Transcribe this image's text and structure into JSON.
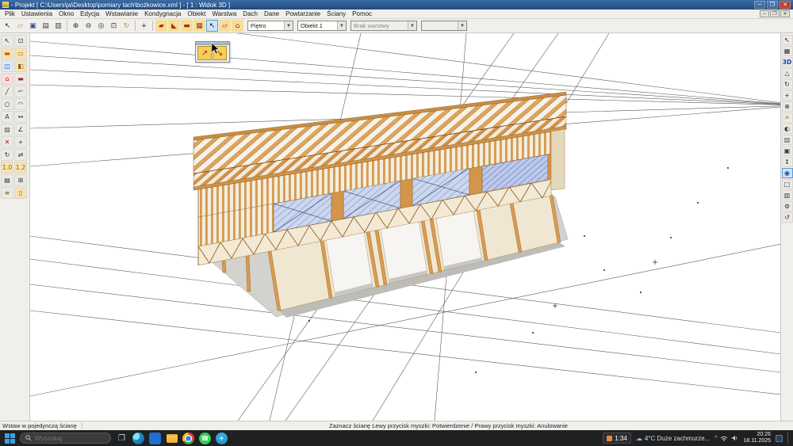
{
  "window": {
    "title": "- Projekt [ C:\\Users\\ja\\Desktop\\pomiary tach\\bożkowice.xml ] - [ 1 : Widok 3D ]",
    "controls": {
      "minimize": "─",
      "maximize": "❐",
      "close": "✕"
    }
  },
  "menu": {
    "items": [
      {
        "name": "menu-plik",
        "label": "Plik"
      },
      {
        "name": "menu-ustawienia",
        "label": "Ustawienia"
      },
      {
        "name": "menu-okno",
        "label": "Okno"
      },
      {
        "name": "menu-edycja",
        "label": "Edycja"
      },
      {
        "name": "menu-wstawianie",
        "label": "Wstawianie"
      },
      {
        "name": "menu-kondygnacja",
        "label": "Kondygnacja"
      },
      {
        "name": "menu-obiekt",
        "label": "Obiekt"
      },
      {
        "name": "menu-warstwa",
        "label": "Warstwa"
      },
      {
        "name": "menu-dach",
        "label": "Dach"
      },
      {
        "name": "menu-dane",
        "label": "Dane"
      },
      {
        "name": "menu-powtarzanie",
        "label": "Powtarzanie"
      },
      {
        "name": "menu-sciany",
        "label": "Ściany"
      },
      {
        "name": "menu-pomoc",
        "label": "Pomoc"
      }
    ],
    "mdi_controls": {
      "minimize": "─",
      "restore": "❐",
      "close": "✕"
    }
  },
  "toolbar": {
    "buttons": [
      {
        "name": "select-button",
        "glyph": "↖",
        "color": "#222"
      },
      {
        "name": "open-button",
        "glyph": "▱",
        "color": "#c09020"
      },
      {
        "name": "save-button",
        "glyph": "▣",
        "color": "#33518c"
      },
      {
        "name": "print-button",
        "glyph": "▤",
        "color": "#444"
      },
      {
        "name": "print-preview-button",
        "glyph": "▥",
        "color": "#444"
      },
      {
        "sep": true
      },
      {
        "name": "zoom-in-button",
        "glyph": "⊕",
        "color": "#333"
      },
      {
        "name": "zoom-out-button",
        "glyph": "⊖",
        "color": "#333"
      },
      {
        "name": "zoom-fit-button",
        "glyph": "◎",
        "color": "#333"
      },
      {
        "name": "zoom-window-button",
        "glyph": "⊡",
        "color": "#333"
      },
      {
        "name": "refresh-button",
        "glyph": "↻",
        "color": "#c8941a"
      },
      {
        "sep": true
      },
      {
        "name": "pan-view-button",
        "glyph": "+",
        "color": "#333"
      },
      {
        "sep": true
      },
      {
        "name": "wall-insert-button",
        "glyph": "▰",
        "color": "#b43010",
        "bg": "#f4df9a"
      },
      {
        "name": "roof-insert-button",
        "glyph": "◣",
        "color": "#b43010",
        "bg": "#f4df9a"
      },
      {
        "name": "beam-insert-button",
        "glyph": "▬",
        "color": "#b43010",
        "bg": "#f4df9a"
      },
      {
        "name": "panel-insert-button",
        "glyph": "▦",
        "color": "#b43010",
        "bg": "#f4df9a"
      },
      {
        "name": "pointer-mode-button",
        "glyph": "↖",
        "color": "#111",
        "active": true
      },
      {
        "name": "wall2-insert-button",
        "glyph": "▱",
        "color": "#b43010",
        "bg": "#f4df9a"
      },
      {
        "name": "roof2-insert-button",
        "glyph": "⌂",
        "color": "#b43010",
        "bg": "#f4df9a"
      }
    ],
    "combos": [
      {
        "name": "floor-combo",
        "value": "Piętro"
      },
      {
        "name": "object-combo",
        "value": "Obiekt 1"
      },
      {
        "name": "layer-combo",
        "value": "Brak warstwy"
      },
      {
        "name": "extra-combo",
        "value": ""
      }
    ]
  },
  "palette": {
    "buttons": [
      {
        "name": "insert-single-wall-button",
        "glyph": "↗"
      },
      {
        "name": "insert-wall-chain-button",
        "glyph": "↘"
      }
    ]
  },
  "left_toolbar": {
    "buttons": [
      {
        "name": "select-tool",
        "glyph": "↖",
        "color": "#222"
      },
      {
        "name": "zoom-window-tool",
        "glyph": "⊡",
        "color": "#333"
      },
      {
        "name": "wall-tool",
        "glyph": "▬",
        "color": "#c05a10",
        "bg": "#f6e3b0"
      },
      {
        "name": "wall2-tool",
        "glyph": "▭",
        "color": "#c05a10",
        "bg": "#f6e3b0"
      },
      {
        "name": "window-tool",
        "glyph": "◫",
        "color": "#2a52b0",
        "bg": "#dfe8fa"
      },
      {
        "name": "door-tool",
        "glyph": "◧",
        "color": "#8a5a20",
        "bg": "#f6e3b0"
      },
      {
        "name": "roof-tool",
        "glyph": "⌂",
        "color": "#b02020",
        "bg": "#fadddd"
      },
      {
        "name": "beam-tool",
        "glyph": "▬",
        "color": "#b02020"
      },
      {
        "name": "line-tool",
        "glyph": "╱",
        "color": "#333"
      },
      {
        "name": "polyline-tool",
        "glyph": "⌐",
        "color": "#333"
      },
      {
        "name": "circle-tool",
        "glyph": "○",
        "color": "#333"
      },
      {
        "name": "arc-tool",
        "glyph": "◠",
        "color": "#333"
      },
      {
        "name": "text-tool",
        "glyph": "A",
        "color": "#223a8c"
      },
      {
        "name": "dimension-tool",
        "glyph": "↔",
        "color": "#333"
      },
      {
        "name": "hatch-tool",
        "glyph": "▨",
        "color": "#555"
      },
      {
        "name": "angle-tool",
        "glyph": "∠",
        "color": "#333"
      },
      {
        "name": "delete-tool",
        "glyph": "✕",
        "color": "#c01010"
      },
      {
        "name": "move-tool",
        "glyph": "+",
        "color": "#333"
      },
      {
        "name": "rotate-tool",
        "glyph": "↻",
        "color": "#333"
      },
      {
        "name": "mirror-tool",
        "glyph": "⇄",
        "color": "#333"
      },
      {
        "name": "scale-tool",
        "glyph": "1.0",
        "color": "#8a6a10",
        "bg": "#f6e3b0"
      },
      {
        "name": "scale2-tool",
        "glyph": "1.2",
        "color": "#8a6a10",
        "bg": "#f6e3b0"
      },
      {
        "name": "layers-tool",
        "glyph": "▤",
        "color": "#333"
      },
      {
        "name": "grid-tool",
        "glyph": "⊞",
        "color": "#333"
      },
      {
        "name": "stairs-tool",
        "glyph": "≡",
        "color": "#8a5a20"
      },
      {
        "name": "column-tool",
        "glyph": "▯",
        "color": "#8a5a20",
        "bg": "#f6e3b0"
      }
    ]
  },
  "right_toolbar": {
    "buttons": [
      {
        "name": "select-3d-tool",
        "glyph": "↖",
        "color": "#222"
      },
      {
        "name": "view-2d-tool",
        "glyph": "▦",
        "color": "#333"
      },
      {
        "name": "view-3d-button",
        "glyph": "3D",
        "b3d": true
      },
      {
        "name": "perspective-tool",
        "glyph": "△",
        "color": "#333"
      },
      {
        "name": "orbit-tool",
        "glyph": "↻",
        "color": "#333"
      },
      {
        "name": "pan-3d-tool",
        "glyph": "+",
        "color": "#333"
      },
      {
        "name": "zoom-3d-tool",
        "glyph": "⊕",
        "color": "#333"
      },
      {
        "name": "sun-tool",
        "glyph": "☀",
        "color": "#c08a10"
      },
      {
        "name": "shadow-tool",
        "glyph": "◐",
        "color": "#333"
      },
      {
        "name": "texture-tool",
        "glyph": "▧",
        "color": "#555"
      },
      {
        "name": "camera-tool",
        "glyph": "▣",
        "color": "#333"
      },
      {
        "name": "walk-tool",
        "glyph": "↕",
        "color": "#333"
      },
      {
        "name": "select-face-tool",
        "glyph": "◉",
        "color": "#1a4a9a",
        "active": true
      },
      {
        "name": "hide-tool",
        "glyph": "□",
        "color": "#333"
      },
      {
        "name": "section-tool",
        "glyph": "▥",
        "color": "#333"
      },
      {
        "name": "settings-3d-tool",
        "glyph": "⚙",
        "color": "#333"
      },
      {
        "name": "refresh-3d-tool",
        "glyph": "↺",
        "color": "#333"
      }
    ]
  },
  "statusbar": {
    "left": "Wstaw w pojedynczą ścianę",
    "center": "Zaznacz ścianę Lewy przycisk myszki: Potwierdzenie / Prawy przycisk myszki: Anulowanie"
  },
  "taskbar": {
    "search_placeholder": "Wyszukaj",
    "timer": "1:34",
    "weather": "4°C Duże zachmurze...",
    "time": "20:26",
    "date": "18.11.2025"
  },
  "colors": {
    "titlebar": "#2a5588",
    "timber": "#d99a4e",
    "glass": "#ccd7ee",
    "accent": "#5b9bd5"
  }
}
